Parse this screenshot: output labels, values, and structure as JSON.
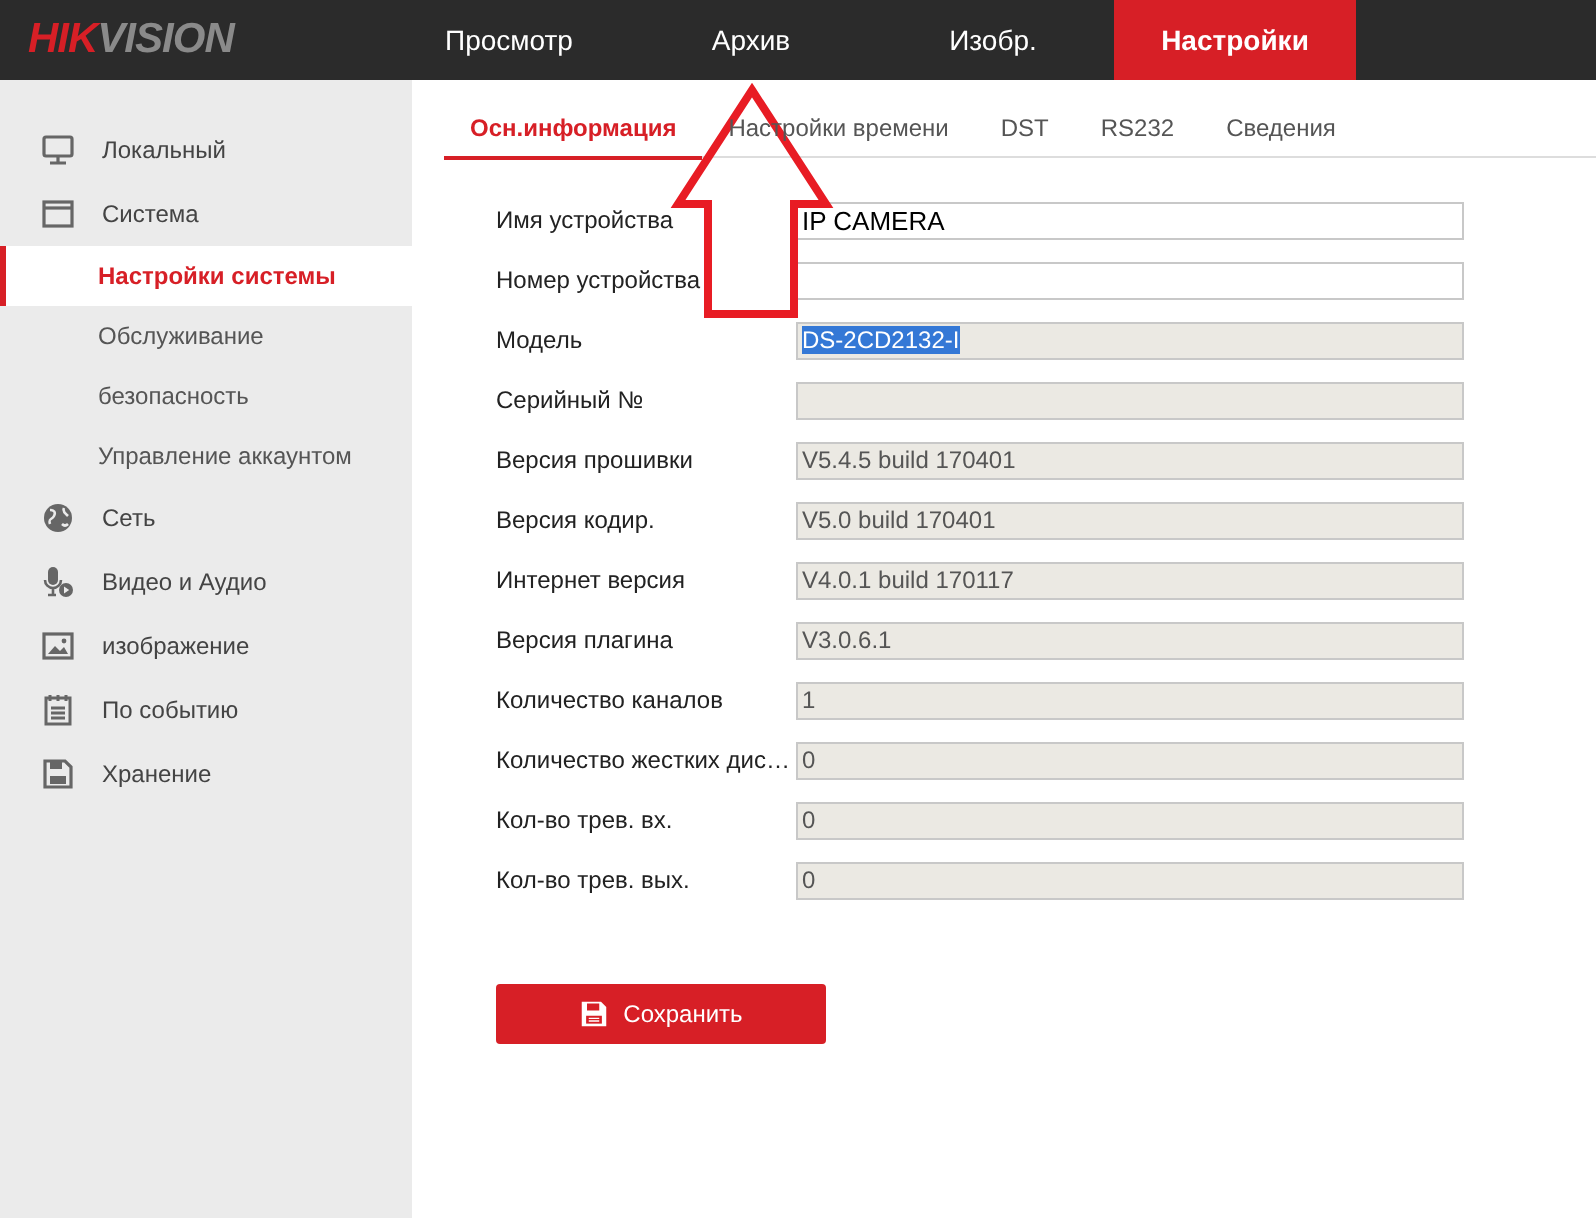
{
  "logo": [
    {
      "text": "HIK",
      "color": "#d71f26"
    },
    {
      "text": "VISION",
      "color": "#8a8a8a"
    }
  ],
  "nav": [
    {
      "label": "Просмотр",
      "selected": false
    },
    {
      "label": "Архив",
      "selected": false
    },
    {
      "label": "Изобр.",
      "selected": false
    },
    {
      "label": "Настройки",
      "selected": true
    }
  ],
  "sidebar": {
    "items": [
      {
        "label": "Локальный",
        "selected": false
      },
      {
        "label": "Система",
        "selected": false,
        "children": [
          {
            "label": "Настройки системы",
            "selected": true
          },
          {
            "label": "Обслуживание",
            "selected": false
          },
          {
            "label": "безопасность",
            "selected": false
          },
          {
            "label": "Управление аккаунтом",
            "selected": false
          }
        ]
      },
      {
        "label": "Сеть",
        "selected": false
      },
      {
        "label": "Видео и Аудио",
        "selected": false
      },
      {
        "label": "изображение",
        "selected": false
      },
      {
        "label": "По событию",
        "selected": false
      },
      {
        "label": "Хранение",
        "selected": false
      }
    ]
  },
  "tabs": [
    {
      "label": "Осн.информация",
      "selected": true
    },
    {
      "label": "Настройки времени",
      "selected": false
    },
    {
      "label": "DST",
      "selected": false
    },
    {
      "label": "RS232",
      "selected": false
    },
    {
      "label": "Сведения",
      "selected": false
    }
  ],
  "fields": [
    {
      "label": "Имя устройства",
      "value": "IP CAMERA",
      "disabled": false
    },
    {
      "label": "Номер устройства",
      "disabled": false
    },
    {
      "label": "Модель",
      "value": "DS-2CD2132-I",
      "disabled": true,
      "highlighted": true
    },
    {
      "label": "Серийный №",
      "disabled": true
    },
    {
      "label": "Версия прошивки",
      "value": "V5.4.5 build 170401",
      "disabled": true
    },
    {
      "label": "Версия кодир.",
      "value": "V5.0 build 170401",
      "disabled": true
    },
    {
      "label": "Интернет версия",
      "value": "V4.0.1 build 170117",
      "disabled": true
    },
    {
      "label": "Версия плагина",
      "value": "V3.0.6.1",
      "disabled": true
    },
    {
      "label": "Количество каналов",
      "value": "1",
      "disabled": true
    },
    {
      "label": "Количество жестких дис…",
      "value": "0",
      "disabled": true
    },
    {
      "label": "Кол-во трев. вх.",
      "value": "0",
      "disabled": true
    },
    {
      "label": "Кол-во трев. вых.",
      "value": "0",
      "disabled": true
    }
  ],
  "save_button": {
    "label": "Сохранить"
  }
}
